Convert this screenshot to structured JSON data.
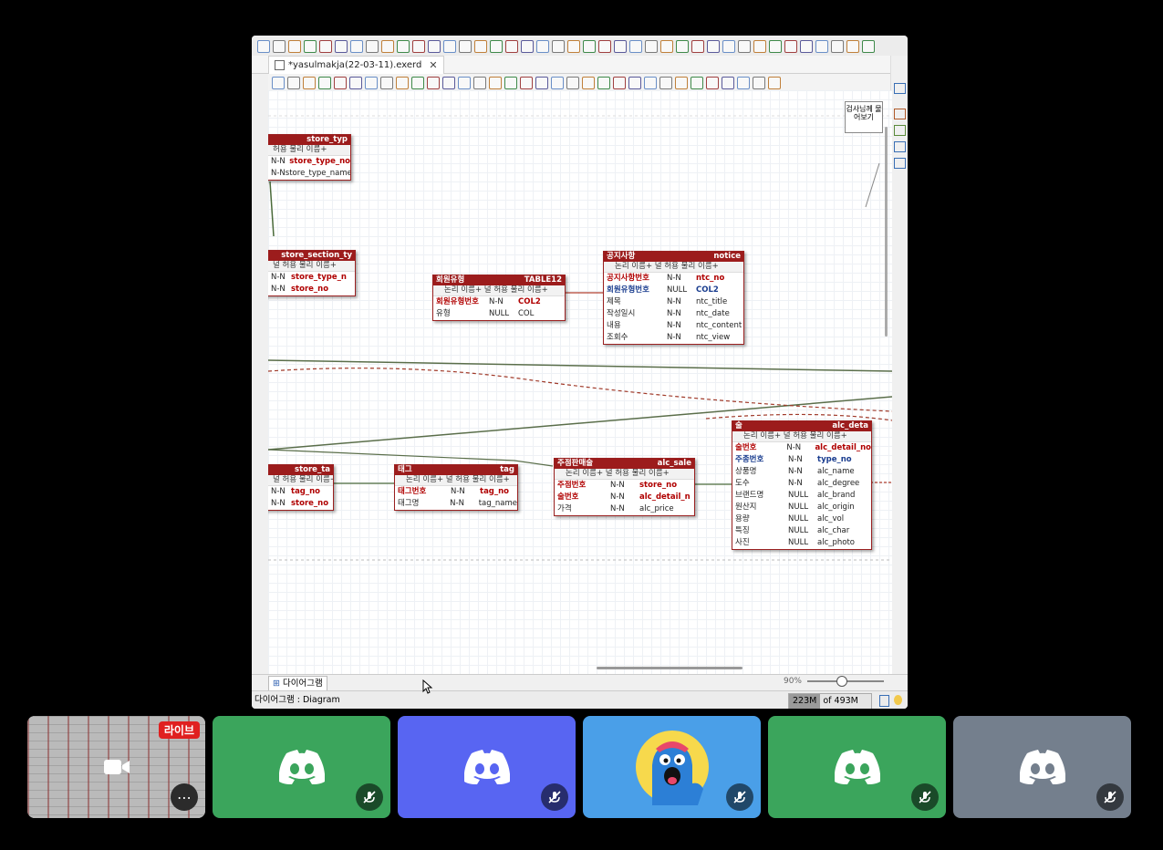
{
  "editor": {
    "tab_title": "*yasulmakja(22-03-11).exerd",
    "callout_text": "검사님께 물어보기",
    "bottom_tab": "다이어그램",
    "zoom": "90%",
    "status_left": "다이어그램 : Diagram",
    "memory_used": "223M",
    "memory_total": "of 493M"
  },
  "tables": {
    "store_type": {
      "title": "store_typ",
      "sub": "허용 물리 이름+",
      "rows": [
        {
          "null": "N-N",
          "phys": "store_type_no",
          "pk": true
        },
        {
          "null": "N-N",
          "phys": "store_type_name",
          "pk": false
        }
      ]
    },
    "store_section": {
      "title": "store_section_ty",
      "sub": "널 허용 물리 이름+",
      "rows": [
        {
          "null": "N-N",
          "phys": "store_type_n"
        },
        {
          "null": "N-N",
          "phys": "store_no"
        }
      ]
    },
    "member_type": {
      "title_l": "회원유형",
      "title_r": "TABLE12",
      "sub": "논리 이름+ 널 허용 물리 이름+",
      "rows": [
        {
          "name": "회원유형번호",
          "null": "N-N",
          "phys": "COL2"
        },
        {
          "name": "유형",
          "null": "NULL",
          "phys": "COL"
        }
      ]
    },
    "notice": {
      "title_l": "공지사항",
      "title_r": "notice",
      "sub": "논리 이름+ 널 허용 물리 이름+",
      "rows": [
        {
          "name": "공지사항번호",
          "null": "N-N",
          "phys": "ntc_no"
        },
        {
          "name": "회원유형번호",
          "null": "NULL",
          "phys": "COL2"
        },
        {
          "name": "제목",
          "null": "N-N",
          "phys": "ntc_title"
        },
        {
          "name": "작성일시",
          "null": "N-N",
          "phys": "ntc_date"
        },
        {
          "name": "내용",
          "null": "N-N",
          "phys": "ntc_content"
        },
        {
          "name": "조회수",
          "null": "N-N",
          "phys": "ntc_view"
        }
      ]
    },
    "store_tag": {
      "title": "store_ta",
      "sub": "널 허용 물리 이름+",
      "rows": [
        {
          "null": "N-N",
          "phys": "tag_no"
        },
        {
          "null": "N-N",
          "phys": "store_no"
        }
      ]
    },
    "tag": {
      "title_l": "태그",
      "title_r": "tag",
      "sub": "논리 이름+ 널 허용 물리 이름+",
      "rows": [
        {
          "name": "태그번호",
          "null": "N-N",
          "phys": "tag_no"
        },
        {
          "name": "태그명",
          "null": "N-N",
          "phys": "tag_name"
        }
      ]
    },
    "alc_sale": {
      "title_l": "주점판매술",
      "title_r": "alc_sale",
      "sub": "논리 이름+ 널 허용 물리 이름+",
      "rows": [
        {
          "name": "주점번호",
          "null": "N-N",
          "phys": "store_no"
        },
        {
          "name": "술번호",
          "null": "N-N",
          "phys": "alc_detail_n"
        },
        {
          "name": "가격",
          "null": "N-N",
          "phys": "alc_price"
        }
      ]
    },
    "alc_detail": {
      "title_l": "술",
      "title_r": "alc_deta",
      "sub": "논리 이름+ 널 허용 물리 이름+",
      "rows": [
        {
          "name": "술번호",
          "null": "N-N",
          "phys": "alc_detail_no"
        },
        {
          "name": "주종번호",
          "null": "N-N",
          "phys": "type_no"
        },
        {
          "name": "상품명",
          "null": "N-N",
          "phys": "alc_name"
        },
        {
          "name": "도수",
          "null": "N-N",
          "phys": "alc_degree"
        },
        {
          "name": "브랜드명",
          "null": "NULL",
          "phys": "alc_brand"
        },
        {
          "name": "원산지",
          "null": "NULL",
          "phys": "alc_origin"
        },
        {
          "name": "용량",
          "null": "NULL",
          "phys": "alc_vol"
        },
        {
          "name": "특징",
          "null": "NULL",
          "phys": "alc_char"
        },
        {
          "name": "사진",
          "null": "NULL",
          "phys": "alc_photo"
        }
      ]
    }
  },
  "participants": {
    "live_badge": "라이브",
    "more_label": "⋯",
    "colors": [
      "#3ba55c",
      "#5865f2",
      "#4a9fe8",
      "#3ba55c",
      "#747f8d"
    ]
  }
}
